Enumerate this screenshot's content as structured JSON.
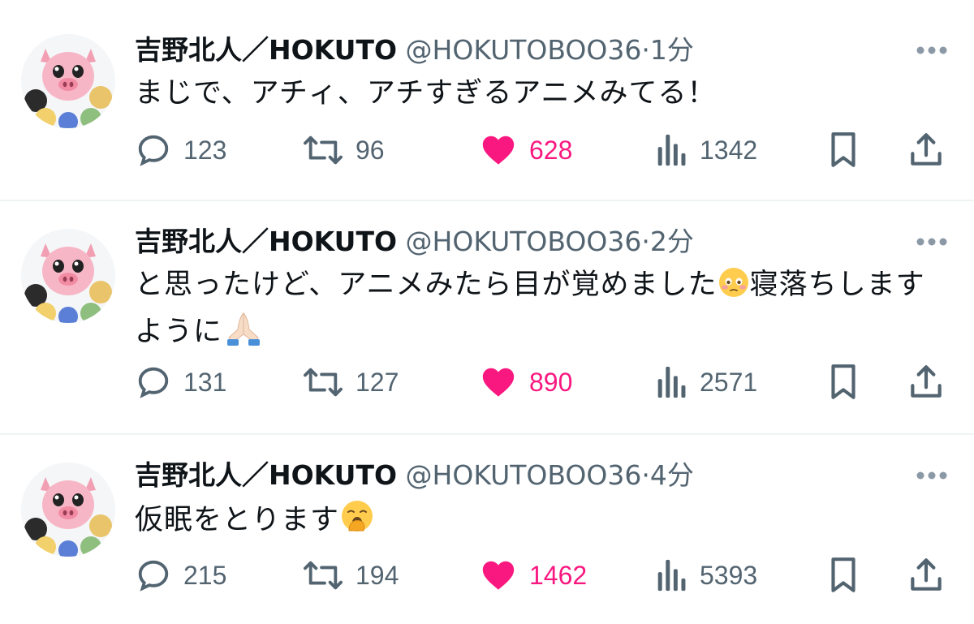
{
  "tweets": [
    {
      "display_name": "吉野北人／HOKUTO",
      "handle": "@HOKUTOBOO36",
      "separator": "·",
      "time": "1分",
      "lines": [
        "まじで、アチィ、アチすぎるアニメみてる！"
      ],
      "replies": "123",
      "retweets": "96",
      "likes": "628",
      "views": "1342",
      "avatar_icon": "pig-avatar-icon"
    },
    {
      "display_name": "吉野北人／HOKUTO",
      "handle": "@HOKUTOBOO36",
      "separator": "·",
      "time": "2分",
      "line1_a": "と思ったけど、アニメみたら目が覚めました",
      "line1_emoji": "flushed-face-emoji",
      "line1_b": "寝落ちします",
      "line2_a": "ように",
      "line2_emoji": "folded-hands-emoji",
      "replies": "131",
      "retweets": "127",
      "likes": "890",
      "views": "2571",
      "avatar_icon": "pig-avatar-icon"
    },
    {
      "display_name": "吉野北人／HOKUTO",
      "handle": "@HOKUTOBOO36",
      "separator": "·",
      "time": "4分",
      "line1_a": "仮眠をとります",
      "line1_emoji": "yawning-face-emoji",
      "replies": "215",
      "retweets": "194",
      "likes": "1462",
      "views": "5393",
      "avatar_icon": "pig-avatar-icon"
    }
  ],
  "colors": {
    "like": "#f91880",
    "secondary_text": "#536471",
    "primary_text": "#0f1419",
    "divider": "#eff3f4"
  }
}
